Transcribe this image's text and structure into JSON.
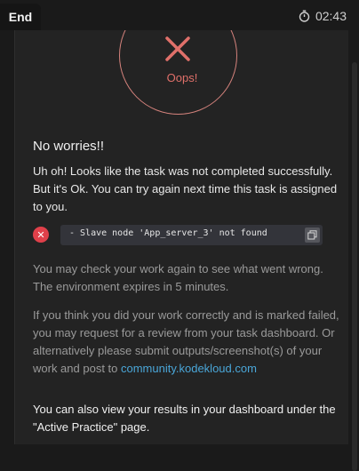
{
  "topbar": {
    "tab_label": "End",
    "timer": "02:43"
  },
  "result": {
    "status_text": "Oops!",
    "colors": {
      "accent": "#d4827c",
      "error": "#e0404a"
    }
  },
  "content": {
    "heading": "No worries!!",
    "intro": "Uh oh! Looks like the task was not completed successfully. But it's Ok. You can try again next time this task is assigned to you.",
    "error_message": "- Slave node 'App_server_3' not found",
    "check_again": "You may check your work again to see what went wrong. The environment expires in 5 minutes.",
    "review_text": "If you think you did your work correctly and is marked failed, you may request for a review from your task dashboard. Or alternatively please submit outputs/screenshot(s) of your work and post to ",
    "community_link": "community.kodekloud.com",
    "dashboard_note": "You can also view your results in your dashboard under the \"Active Practice\" page."
  }
}
